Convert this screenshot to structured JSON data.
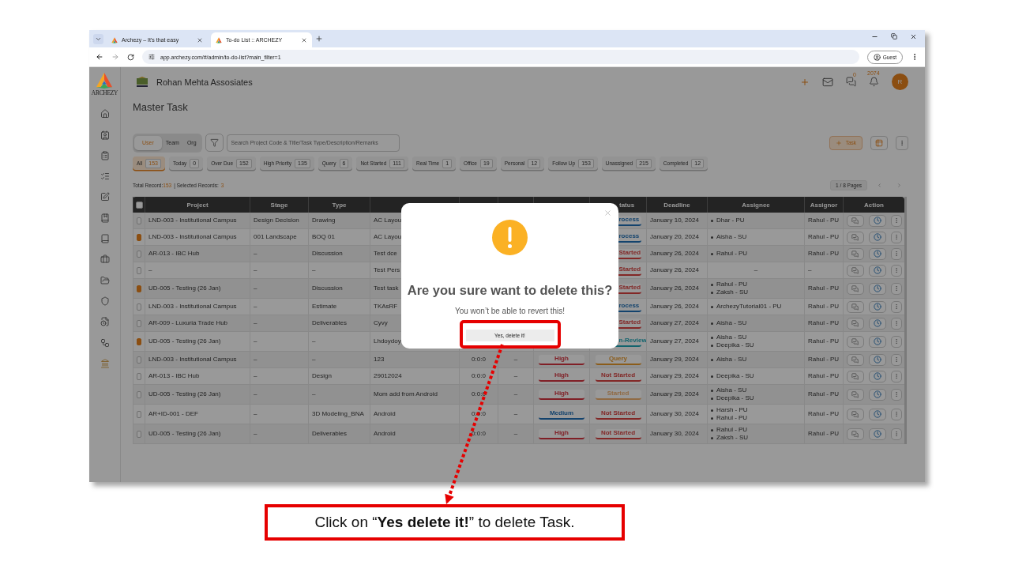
{
  "browser": {
    "tabs": [
      {
        "label": "Archezy – It's that easy",
        "selected": false
      },
      {
        "label": "To-do List :: ARCHEZY",
        "selected": true
      }
    ],
    "url": "app.archezy.com/#/admin/to-do-list?main_filter=1",
    "profile": "Guest"
  },
  "sidebar": {
    "logo_text": "ARCHEZY"
  },
  "header": {
    "company": "Rohan Mehta Assosiates",
    "chat_count": "0",
    "notification_count": "2074",
    "avatar": "R"
  },
  "page_title": "Master Task",
  "toolbar": {
    "scopes": [
      {
        "label": "User",
        "selected": true
      },
      {
        "label": "Team",
        "selected": false
      },
      {
        "label": "Org",
        "selected": false
      }
    ],
    "search": {
      "placeholder": "Search Project Code & Title/Task Type/Description/Remarks"
    },
    "add_button": "Task"
  },
  "filters": [
    {
      "label": "All",
      "count": "153",
      "selected": true
    },
    {
      "label": "Today",
      "count": "0",
      "selected": false
    },
    {
      "label": "Over Due",
      "count": "152",
      "selected": false
    },
    {
      "label": "High Priority",
      "count": "135",
      "selected": false
    },
    {
      "label": "Query",
      "count": "6",
      "selected": false
    },
    {
      "label": "Not Started",
      "count": "111",
      "selected": false
    },
    {
      "label": "Real Time",
      "count": "1",
      "selected": false
    },
    {
      "label": "Office",
      "count": "19",
      "selected": false
    },
    {
      "label": "Personal",
      "count": "12",
      "selected": false
    },
    {
      "label": "Follow Up",
      "count": "153",
      "selected": false
    },
    {
      "label": "Unassigned",
      "count": "215",
      "selected": false
    },
    {
      "label": "Completed",
      "count": "12",
      "selected": false
    }
  ],
  "summary": {
    "total_label": "Total Record:",
    "total": "153",
    "selected_label": "| Selected Records:",
    "selected": "3",
    "pages": "1 / 8 Pages"
  },
  "table": {
    "select_all_checked": false,
    "header": {
      "project": "Project",
      "stage": "Stage",
      "type": "Type",
      "status": "tatus",
      "deadline": "Deadline",
      "assignee": "Assignee",
      "assignor": "Assignor",
      "action": "Action"
    },
    "rows": [
      {
        "checked": false,
        "project": "LND-003 - Institutional Campus",
        "stage": "Design Decision",
        "type": "Drawing",
        "title": "AC Layou",
        "status": {
          "label": "rocess",
          "color": "#13436d",
          "cut": true
        },
        "deadline": "January 10, 2024",
        "assignees": [
          "Dhar - PU"
        ],
        "assignor": "Rahul - PU"
      },
      {
        "checked": true,
        "project": "LND-003 - Institutional Campus",
        "stage": "001 Landscape",
        "type": "BOQ 01",
        "title": "AC Layou",
        "status": {
          "label": "rocess",
          "color": "#13436d",
          "cut": true
        },
        "deadline": "January 20, 2024",
        "assignees": [
          "Aisha - SU"
        ],
        "assignor": "Rahul - PU"
      },
      {
        "checked": false,
        "project": "AR-013 - IBC Hub",
        "stage": "–",
        "type": "Discussion",
        "title": "Test dce",
        "status": {
          "label": "Started",
          "color": "#822726",
          "cut": true
        },
        "deadline": "January 26, 2024",
        "assignees": [
          "Rahul - PU"
        ],
        "assignor": "Rahul - PU"
      },
      {
        "checked": false,
        "project": "–",
        "stage": "–",
        "type": "–",
        "title": "Test Pers",
        "status": {
          "label": "Started",
          "color": "#822726",
          "cut": true
        },
        "deadline": "January 26, 2024",
        "assignees": "–",
        "assignor": "–"
      },
      {
        "checked": true,
        "project": "UD-005 - Testing (26 Jan)",
        "stage": "–",
        "type": "Discussion",
        "title": "Test task",
        "status": {
          "label": "Started",
          "color": "#822726",
          "cut": true
        },
        "deadline": "January 26, 2024",
        "assignees": [
          "Rahul - PU",
          "Zaksh - SU"
        ],
        "assignor": "Rahul - PU"
      },
      {
        "checked": false,
        "project": "LND-003 - Institutional Campus",
        "stage": "–",
        "type": "Estimate",
        "title": "TKAsRF",
        "status": {
          "label": "rocess",
          "color": "#13436d",
          "cut": true
        },
        "deadline": "January 26, 2024",
        "assignees": [
          "ArchezyTutorial01 - PU"
        ],
        "assignor": "Rahul - PU"
      },
      {
        "checked": false,
        "project": "AR-009 - Luxuria Trade Hub",
        "stage": "–",
        "type": "Deliverables",
        "title": "Cyvy",
        "status": {
          "label": "Started",
          "color": "#822726",
          "cut": true
        },
        "deadline": "January 27, 2024",
        "assignees": [
          "Aisha - SU"
        ],
        "assignor": "Rahul - PU"
      },
      {
        "checked": true,
        "project": "UD-005 - Testing (26 Jan)",
        "stage": "–",
        "type": "–",
        "title": "Lhdoydoy",
        "status": {
          "label": "n-Review",
          "color": "#12646e",
          "cut": true
        },
        "deadline": "January 27, 2024",
        "assignees": [
          "Aisha - SU",
          "Deepika - SU"
        ],
        "assignor": "Rahul - PU"
      },
      {
        "checked": false,
        "project": "LND-003 - Institutional Campus",
        "stage": "–",
        "type": "–",
        "title": "123",
        "time": "0:0:0",
        "column_6": "–",
        "priority": {
          "label": "High",
          "color": "#801f26"
        },
        "status": {
          "label": "Query",
          "color": "#8b5c1a"
        },
        "deadline": "January 29, 2024",
        "assignees": [
          "Aisha - SU"
        ],
        "assignor": "Rahul - PU"
      },
      {
        "checked": false,
        "project": "AR-013 - IBC Hub",
        "stage": "–",
        "type": "Design",
        "title": "29012024",
        "time": "0:0:0",
        "column_6": "–",
        "priority": {
          "label": "High",
          "color": "#801f26"
        },
        "status": {
          "label": "Not Started",
          "color": "#822726"
        },
        "deadline": "January 29, 2024",
        "assignees": [
          "Deepika - SU"
        ],
        "assignor": "Rahul - PU"
      },
      {
        "checked": false,
        "project": "UD-005 - Testing (26 Jan)",
        "stage": "–",
        "type": "–",
        "title": "Mom add from Android",
        "time": "0:0:0",
        "column_6": "–",
        "priority": {
          "label": "High",
          "color": "#801f26"
        },
        "status": {
          "label": "Started",
          "color": "#906a44"
        },
        "deadline": "January 29, 2024",
        "assignees": [
          "Aisha - SU",
          "Deepika - SU"
        ],
        "assignor": "Rahul - PU"
      },
      {
        "checked": false,
        "project": "AR+ID-001 - DEF",
        "stage": "–",
        "type": "3D Modeling_BNA",
        "title": "Android",
        "time": "0:0:0",
        "column_6": "–",
        "priority": {
          "label": "Medium",
          "color": "#13436d"
        },
        "status": {
          "label": "Not Started",
          "color": "#822726"
        },
        "deadline": "January 30, 2024",
        "assignees": [
          "Harsh - PU",
          "Rahul - PU"
        ],
        "assignor": "Rahul - PU"
      },
      {
        "checked": false,
        "project": "UD-005 - Testing (26 Jan)",
        "stage": "–",
        "type": "Deliverables",
        "title": "Android",
        "time": "0:0:0",
        "column_6": "–",
        "priority": {
          "label": "High",
          "color": "#801f26"
        },
        "status": {
          "label": "Not Started",
          "color": "#822726"
        },
        "deadline": "January 30, 2024",
        "assignees": [
          "Rahul - PU",
          "Zaksh - SU"
        ],
        "assignor": "Rahul - PU"
      }
    ]
  },
  "dialog": {
    "title": "Are you sure want to delete this?",
    "text": "You won’t be able to revert this!",
    "confirm": "Yes, delete it!"
  },
  "callout": "Click on “**Yes delete it!**” to delete Task."
}
